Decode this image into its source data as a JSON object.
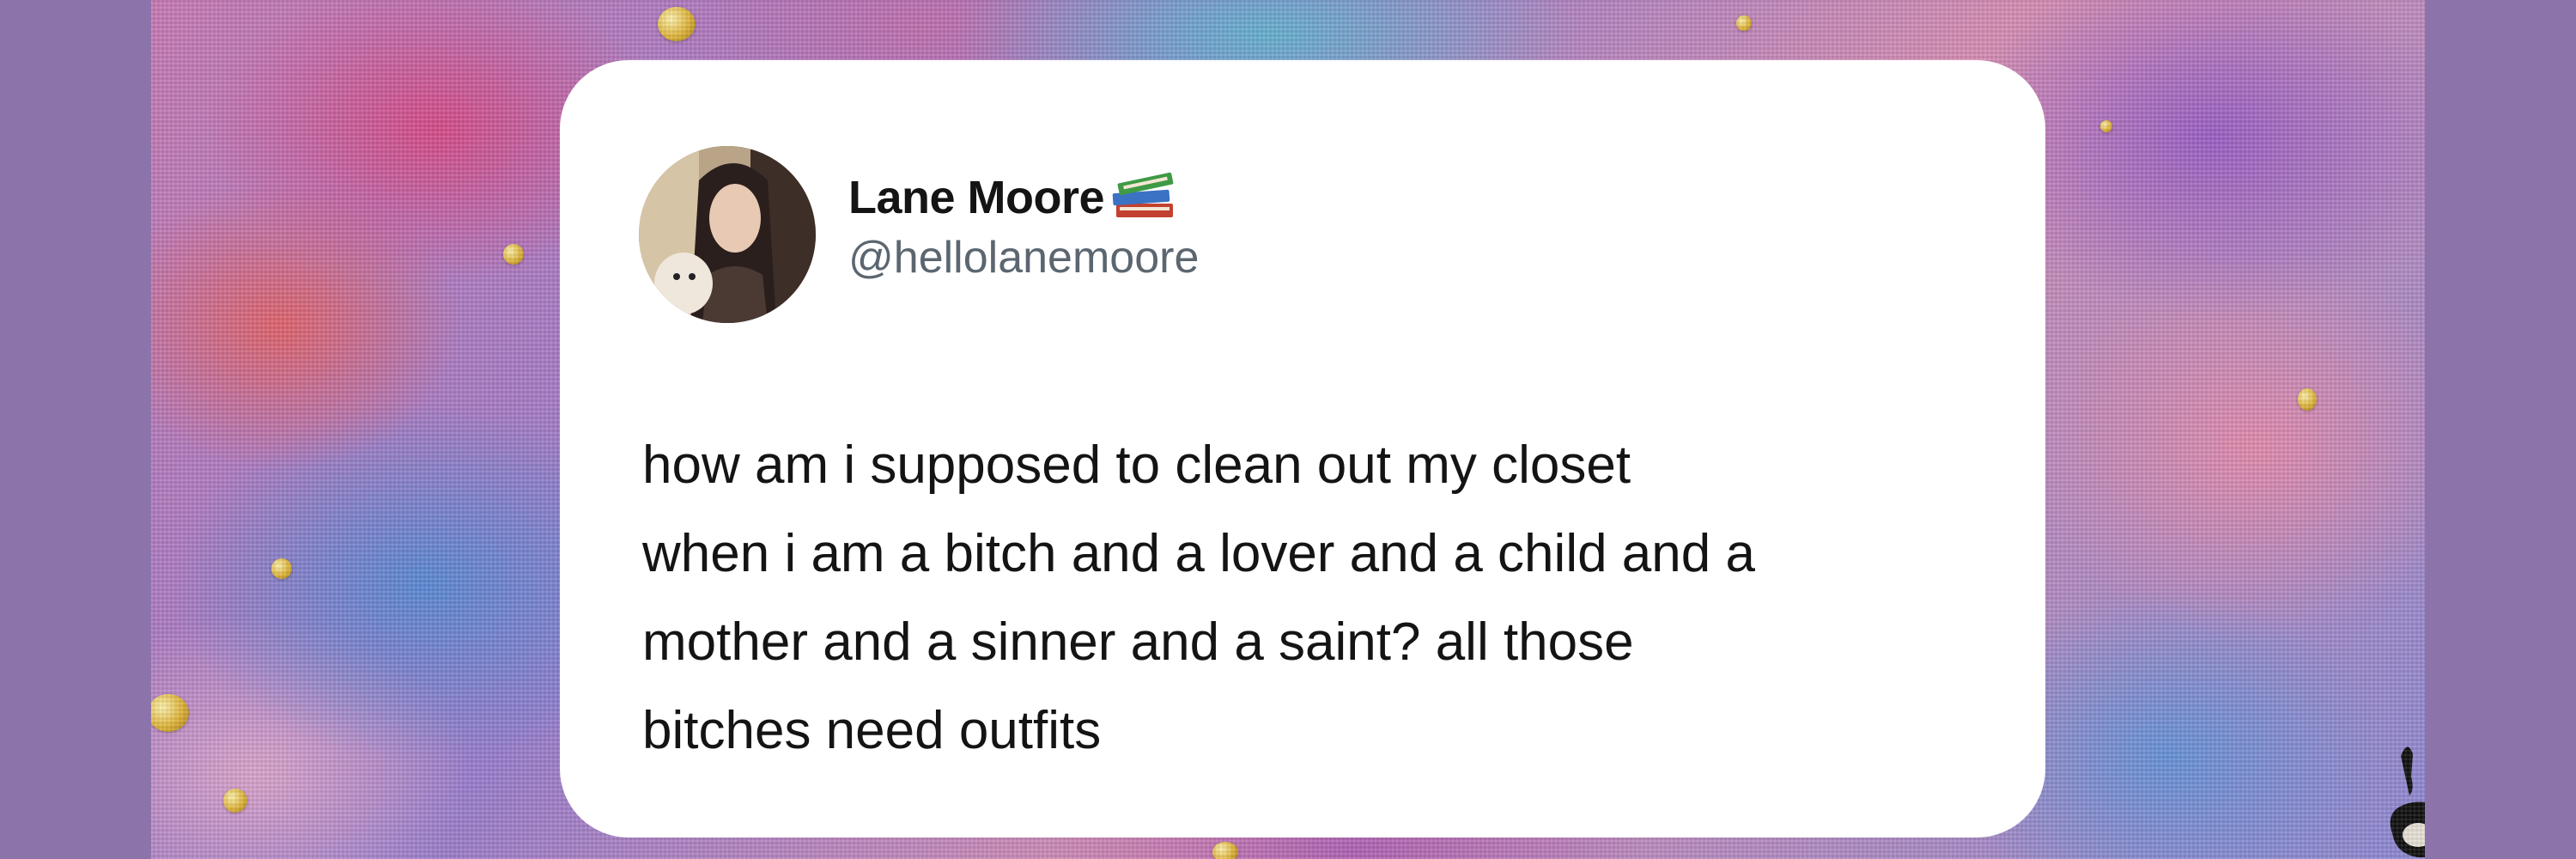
{
  "post": {
    "author_name": "Lane Moore",
    "author_handle": "@hellolanemoore",
    "name_emoji": "books-icon",
    "avatar": "avatar-photo",
    "text_lines": [
      "how am i supposed to clean out my closet",
      "when i am a bitch and a lover and a child and a",
      "mother and a sinner and a saint? all those",
      "bitches need outfits"
    ]
  },
  "colors": {
    "border": "#8c74ab",
    "card_background": "#ffffff",
    "text": "#141414",
    "handle_text": "#5b6670",
    "gold_accent": "#e0b53a"
  }
}
